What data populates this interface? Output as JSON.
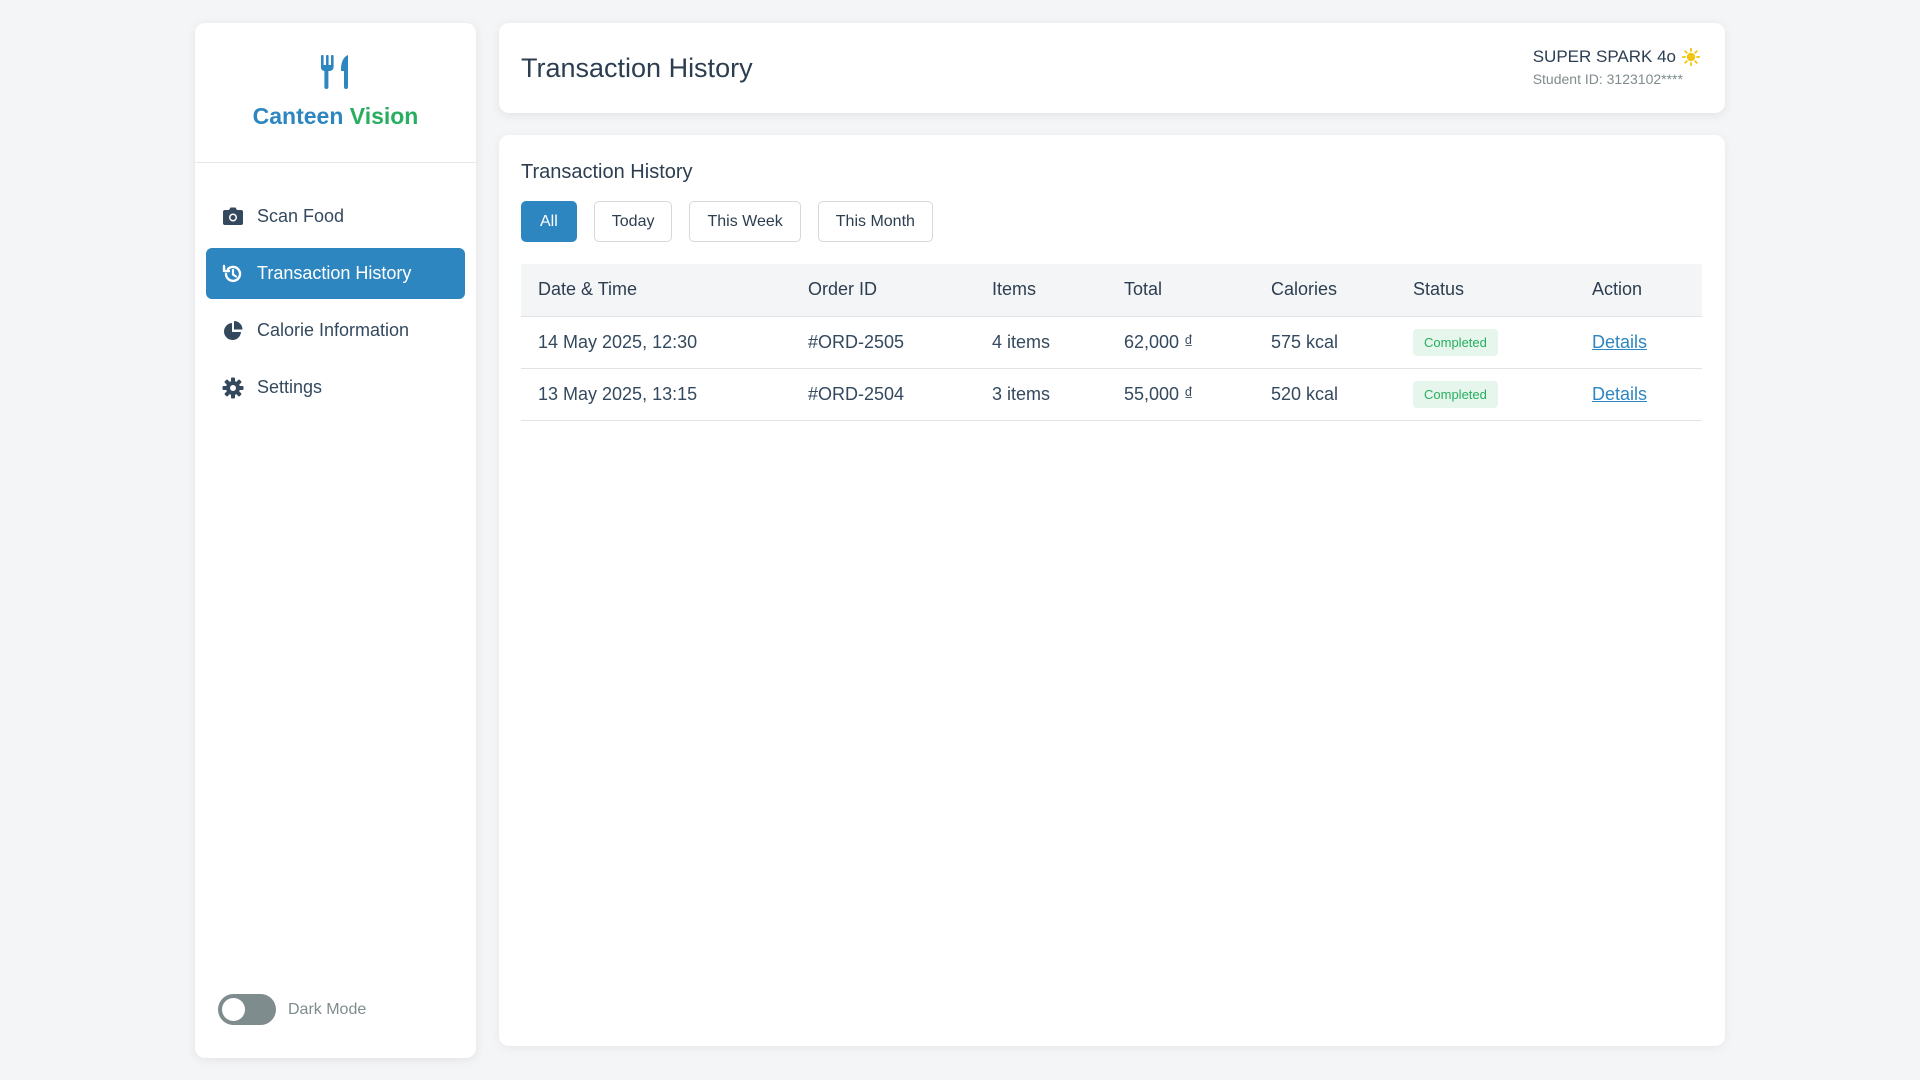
{
  "brand": {
    "name_part1": "Canteen",
    "name_part2": "Vision",
    "icon": "utensils-icon"
  },
  "sidebar": {
    "items": [
      {
        "label": "Scan Food",
        "icon": "camera-icon",
        "active": false
      },
      {
        "label": "Transaction History",
        "icon": "history-icon",
        "active": true
      },
      {
        "label": "Calorie Information",
        "icon": "pie-chart-icon",
        "active": false
      },
      {
        "label": "Settings",
        "icon": "gear-icon",
        "active": false
      }
    ],
    "dark_mode_label": "Dark Mode",
    "dark_mode_on": false
  },
  "header": {
    "title": "Transaction History",
    "user_name": "SUPER SPARK 4o",
    "user_id": "Student ID: 3123102****",
    "user_icon": "sun-icon"
  },
  "main": {
    "section_title": "Transaction History",
    "filters": [
      {
        "label": "All",
        "active": true
      },
      {
        "label": "Today",
        "active": false
      },
      {
        "label": "This Week",
        "active": false
      },
      {
        "label": "This Month",
        "active": false
      }
    ],
    "table": {
      "headers": [
        "Date & Time",
        "Order ID",
        "Items",
        "Total",
        "Calories",
        "Status",
        "Action"
      ],
      "rows": [
        {
          "datetime": "14 May 2025, 12:30",
          "order_id": "#ORD-2505",
          "items": "4 items",
          "total": "62,000 ₫",
          "calories": "575 kcal",
          "status": "Completed",
          "action": "Details"
        },
        {
          "datetime": "13 May 2025, 13:15",
          "order_id": "#ORD-2504",
          "items": "3 items",
          "total": "55,000 ₫",
          "calories": "520 kcal",
          "status": "Completed",
          "action": "Details"
        }
      ]
    }
  },
  "colors": {
    "accent": "#2e86c1",
    "brand_green": "#27ae60",
    "status_bg": "#e6f6ec"
  }
}
